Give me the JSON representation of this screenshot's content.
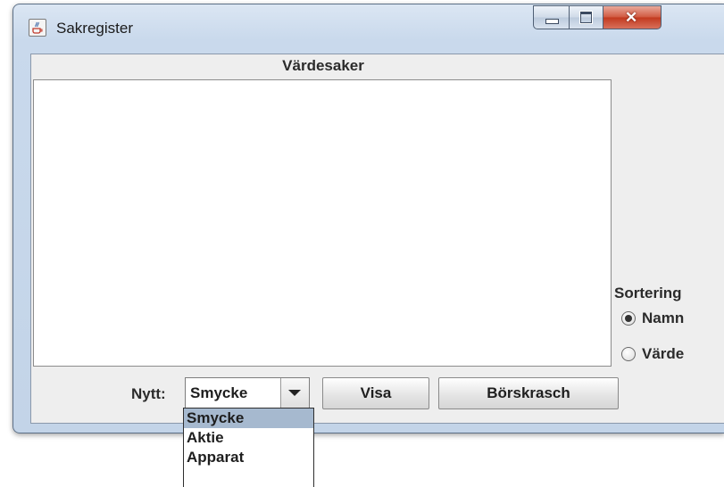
{
  "window": {
    "title": "Sakregister",
    "icon": "java-cup-icon",
    "controls": [
      "minimize",
      "maximize",
      "close"
    ],
    "close_symbol": "✕"
  },
  "list": {
    "title": "Värdesaker",
    "items": []
  },
  "sort": {
    "label": "Sortering",
    "options": [
      {
        "label": "Namn",
        "selected": true
      },
      {
        "label": "Värde",
        "selected": false
      }
    ]
  },
  "bottom": {
    "nytt_label": "Nytt:",
    "combo_value": "Smycke",
    "visa_label": "Visa",
    "borskrasch_label": "Börskrasch"
  },
  "dropdown": {
    "items": [
      {
        "label": "Smycke",
        "selected": true
      },
      {
        "label": "Aktie",
        "selected": false
      },
      {
        "label": "Apparat",
        "selected": false
      }
    ]
  },
  "colors": {
    "selection_highlight": "#a6b9cf",
    "close_button": "#c2391e"
  }
}
